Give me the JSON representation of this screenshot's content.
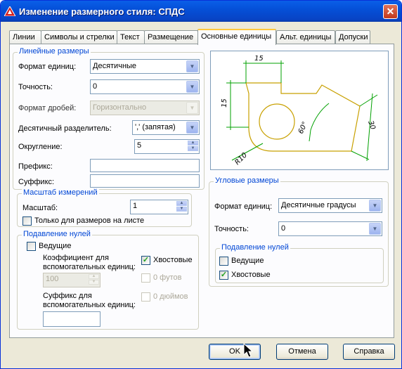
{
  "window": {
    "title": "Изменение размерного стиля: СПДС",
    "close": "✕"
  },
  "tabs": [
    "Линии",
    "Символы и стрелки",
    "Текст",
    "Размещение",
    "Основные единицы",
    "Альт. единицы",
    "Допуски"
  ],
  "linear": {
    "title": "Линейные размеры",
    "unit_format_label": "Формат единиц:",
    "unit_format_value": "Десятичные",
    "precision_label": "Точность:",
    "precision_value": "0",
    "fraction_label": "Формат дробей:",
    "fraction_value": "Горизонтально",
    "decimal_sep_label": "Десятичный  разделитель:",
    "decimal_sep_value": "',' (запятая)",
    "roundoff_label": "Округление:",
    "roundoff_value": "5",
    "prefix_label": "Префикс:",
    "prefix_value": "",
    "suffix_label": "Суффикс:",
    "suffix_value": ""
  },
  "scale": {
    "title": "Масштаб измерений",
    "factor_label": "Масштаб:",
    "factor_value": "1",
    "layout_only_label": "Только для размеров на листе",
    "layout_only_checked": false
  },
  "zero": {
    "title": "Подавление нулей",
    "leading_label": "Ведущие",
    "leading_checked": false,
    "subunit_factor_label": "Коэффициент для вспомогательных единиц:",
    "subunit_factor_value": "100",
    "trailing_label": "Хвостовые",
    "trailing_checked": true,
    "feet_label": "0 футов",
    "inches_label": "0 дюймов",
    "subunit_suffix_label": "Суффикс для вспомогательных единиц:",
    "subunit_suffix_value": ""
  },
  "preview": {
    "dim_top": "15",
    "dim_left": "15",
    "dim_right": "30",
    "dim_angle": "60°",
    "dim_radius": "R10"
  },
  "angular": {
    "title": "Угловые размеры",
    "unit_format_label": "Формат единиц:",
    "unit_format_value": "Десятичные градусы",
    "precision_label": "Точность:",
    "precision_value": "0",
    "zero_title": "Подавление нулей",
    "leading_label": "Ведущие",
    "leading_checked": false,
    "trailing_label": "Хвостовые",
    "trailing_checked": true
  },
  "buttons": {
    "ok": "OK",
    "cancel": "Отмена",
    "help": "Справка"
  },
  "colors": {
    "title_bar": "#0550d8",
    "group_title": "#0046d5",
    "preview_geometry": "#c8a000",
    "preview_dims": "#00a000"
  }
}
